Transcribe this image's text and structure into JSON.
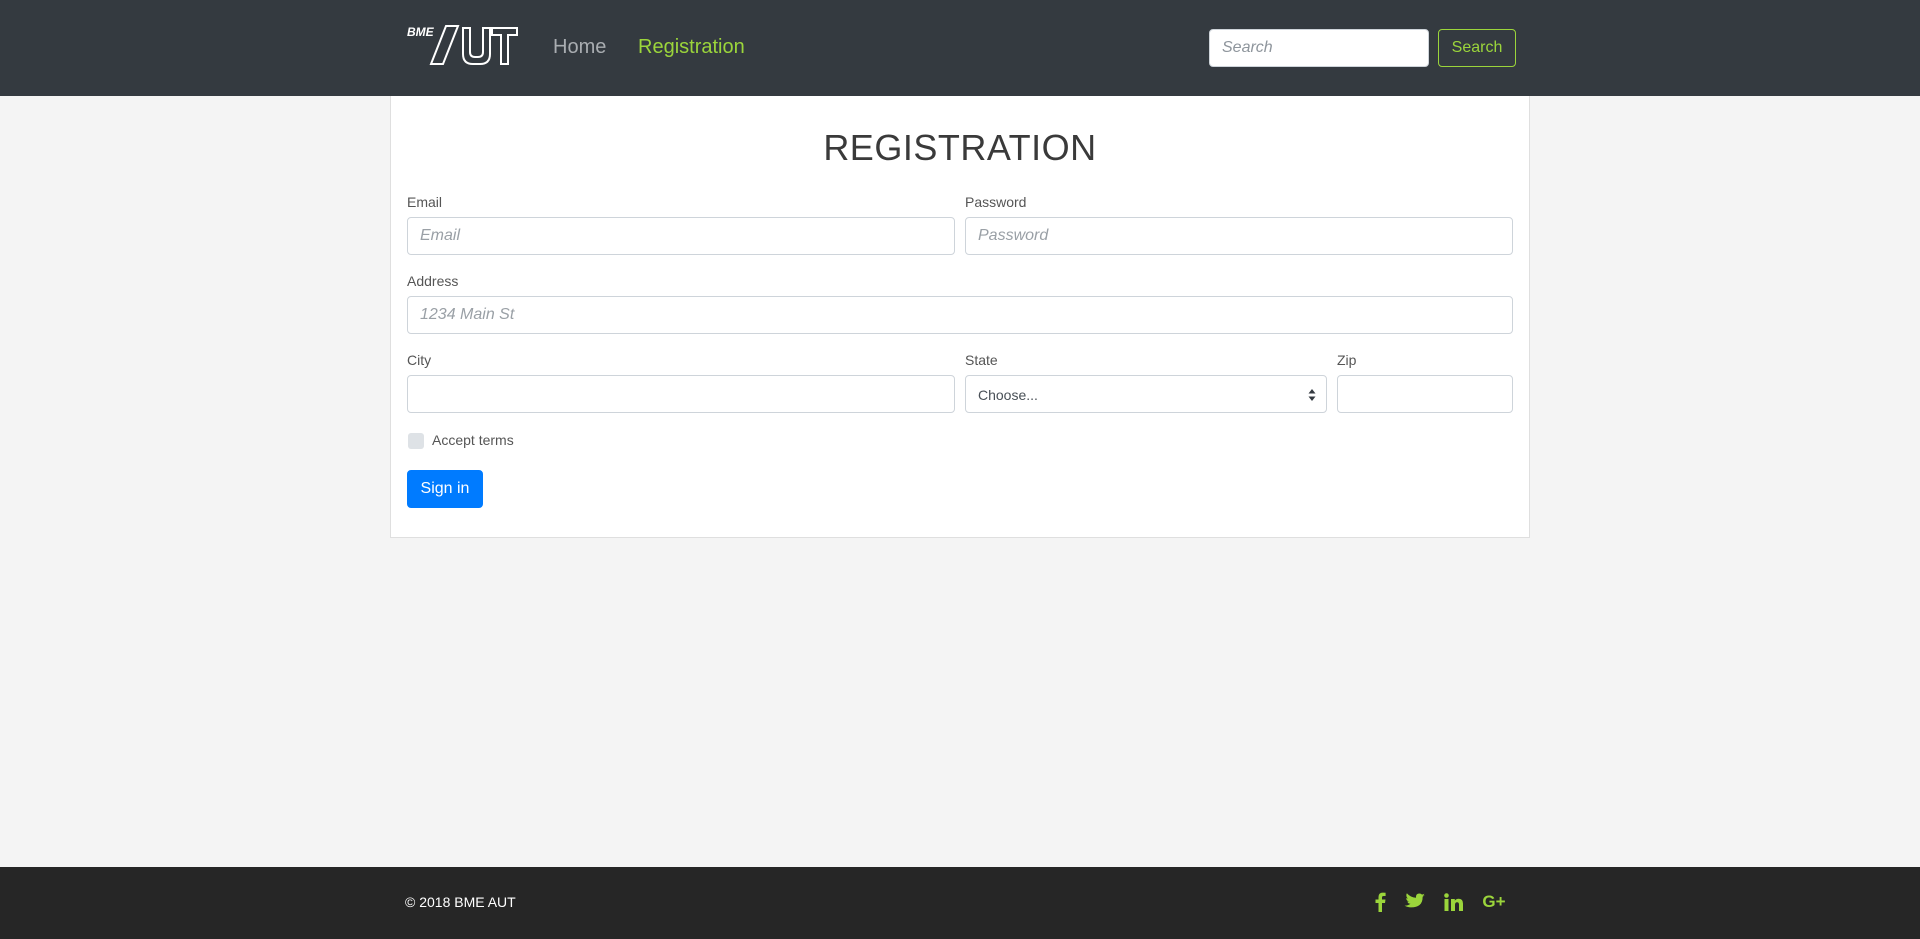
{
  "navbar": {
    "logo_text": "BME AUT",
    "links": [
      {
        "label": "Home",
        "active": false
      },
      {
        "label": "Registration",
        "active": true
      }
    ],
    "search": {
      "placeholder": "Search",
      "button_label": "Search"
    }
  },
  "form": {
    "title": "REGISTRATION",
    "email": {
      "label": "Email",
      "placeholder": "Email"
    },
    "password": {
      "label": "Password",
      "placeholder": "Password"
    },
    "address": {
      "label": "Address",
      "placeholder": "1234 Main St"
    },
    "city": {
      "label": "City",
      "value": ""
    },
    "state": {
      "label": "State",
      "selected": "Choose..."
    },
    "zip": {
      "label": "Zip",
      "value": ""
    },
    "terms": {
      "label": "Accept terms",
      "checked": false
    },
    "submit_label": "Sign in"
  },
  "footer": {
    "copyright": "© 2018 BME AUT",
    "social": [
      "facebook-icon",
      "twitter-icon",
      "linkedin-icon",
      "google-plus-icon"
    ],
    "google_plus_text": "G+"
  },
  "colors": {
    "navbar_bg": "#343a40",
    "accent": "#9bd53b",
    "primary": "#007bff",
    "footer_bg": "#262626",
    "page_bg": "#f4f4f4"
  }
}
